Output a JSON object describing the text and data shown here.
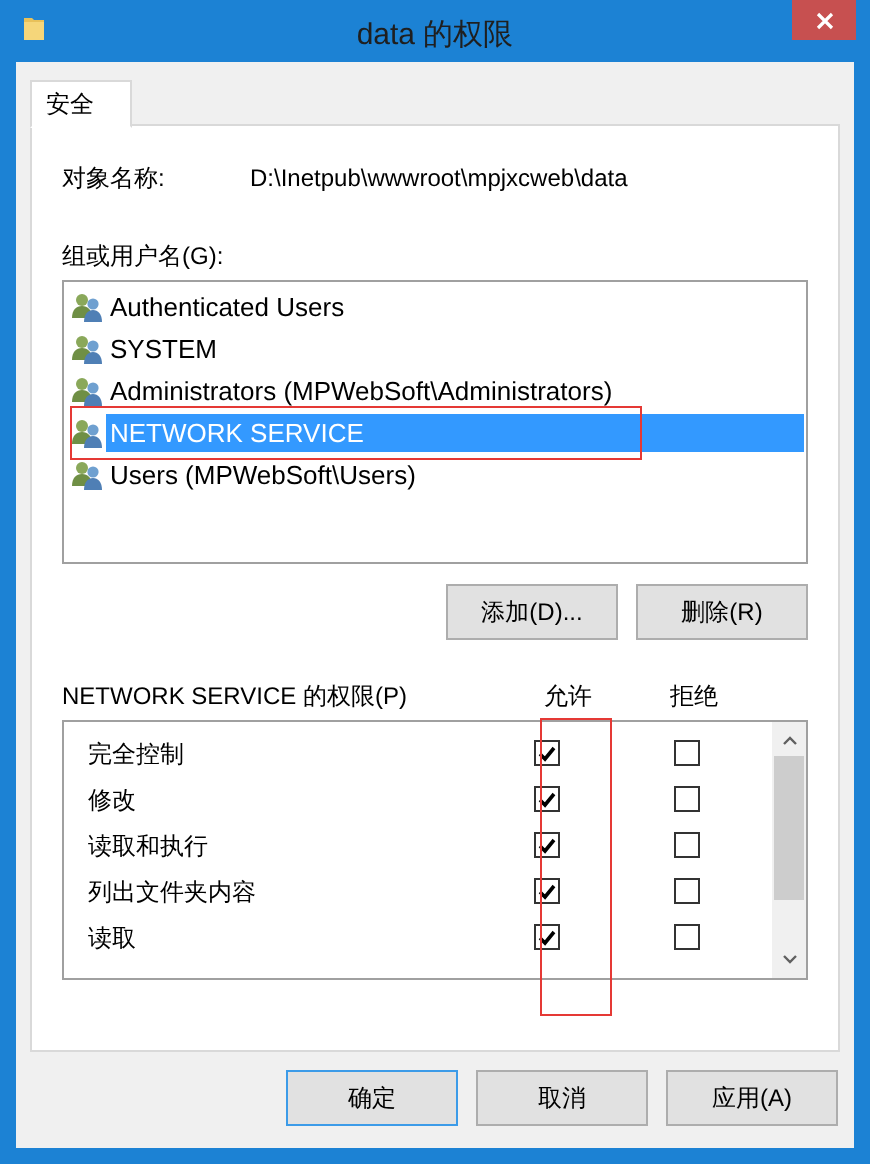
{
  "window": {
    "title": "data 的权限"
  },
  "tabs": [
    {
      "label": "安全",
      "selected": true
    }
  ],
  "object_name": {
    "label": "对象名称:",
    "value": "D:\\Inetpub\\wwwroot\\mpjxcweb\\data"
  },
  "users": {
    "label": "组或用户名(G):",
    "items": [
      {
        "name": "Authenticated Users",
        "selected": false,
        "annotated": false
      },
      {
        "name": "SYSTEM",
        "selected": false,
        "annotated": false
      },
      {
        "name": "Administrators (MPWebSoft\\Administrators)",
        "selected": false,
        "annotated": false
      },
      {
        "name": "NETWORK SERVICE",
        "selected": true,
        "annotated": true
      },
      {
        "name": "Users (MPWebSoft\\Users)",
        "selected": false,
        "annotated": false
      }
    ]
  },
  "user_buttons": [
    "添加(D)...",
    "删除(R)"
  ],
  "permissions": {
    "label": "NETWORK SERVICE 的权限(P)",
    "allow_header": "允许",
    "deny_header": "拒绝",
    "allow_annotated": true,
    "rows": [
      {
        "name": "完全控制",
        "allow": true,
        "deny": false
      },
      {
        "name": "修改",
        "allow": true,
        "deny": false
      },
      {
        "name": "读取和执行",
        "allow": true,
        "deny": false
      },
      {
        "name": "列出文件夹内容",
        "allow": true,
        "deny": false
      },
      {
        "name": "读取",
        "allow": true,
        "deny": false
      }
    ]
  },
  "buttons": [
    {
      "label": "确定",
      "default": true
    },
    {
      "label": "取消",
      "default": false
    },
    {
      "label": "应用(A)",
      "default": false
    }
  ]
}
